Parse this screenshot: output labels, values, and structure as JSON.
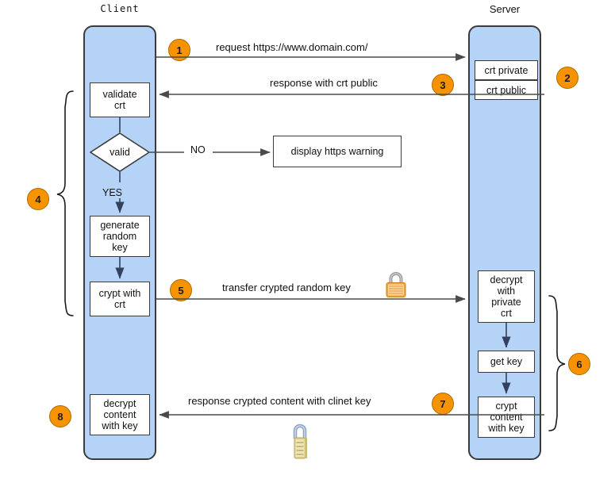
{
  "diagram": {
    "title_client": "Client",
    "title_server": "Server",
    "lanes": [
      {
        "name": "client",
        "label": "Client"
      },
      {
        "name": "server",
        "label": "Server"
      }
    ],
    "client_nodes": [
      {
        "id": "validate-crt",
        "label": "validate\ncrt"
      },
      {
        "id": "valid-decision",
        "label": "valid"
      },
      {
        "id": "generate-random-key",
        "label": "generate\nrandom\nkey"
      },
      {
        "id": "crypt-with-crt",
        "label": "crypt with\ncrt"
      },
      {
        "id": "decrypt-content-with-key",
        "label": "decrypt\ncontent\nwith key"
      }
    ],
    "server_nodes": [
      {
        "id": "crt-private",
        "label": "crt private"
      },
      {
        "id": "crt-public",
        "label": "crt public"
      },
      {
        "id": "decrypt-with-private-crt",
        "label": "decrypt\nwith\nprivate\ncrt"
      },
      {
        "id": "get-key",
        "label": "get key"
      },
      {
        "id": "crypt-content-with-key",
        "label": "crypt\ncontent\nwith key"
      }
    ],
    "external_nodes": [
      {
        "id": "display-https-warning",
        "label": "display https warning"
      }
    ],
    "edge_labels": {
      "no": "NO",
      "yes": "YES"
    },
    "messages": [
      {
        "id": "request",
        "label": "request https://www.domain.com/",
        "badge": "1"
      },
      {
        "id": "response-crt-public",
        "label": "response with crt public",
        "badge": "3"
      },
      {
        "id": "transfer-key",
        "label": "transfer crypted random key",
        "badge": "5"
      },
      {
        "id": "response-content",
        "label": "response crypted content with clinet key",
        "badge": "7"
      }
    ],
    "badges": [
      {
        "id": "badge-1",
        "label": "1"
      },
      {
        "id": "badge-2",
        "label": "2"
      },
      {
        "id": "badge-3",
        "label": "3"
      },
      {
        "id": "badge-4",
        "label": "4"
      },
      {
        "id": "badge-5",
        "label": "5"
      },
      {
        "id": "badge-6",
        "label": "6"
      },
      {
        "id": "badge-7",
        "label": "7"
      },
      {
        "id": "badge-8",
        "label": "8"
      }
    ],
    "icons": [
      {
        "id": "padlock-orange",
        "name": "padlock-icon"
      },
      {
        "id": "padlock-combination",
        "name": "combination-padlock-icon"
      }
    ],
    "colors": {
      "lane_fill": "#b5d2f7",
      "lane_stroke": "#3b3b3b",
      "badge_fill": "#f79200",
      "badge_stroke": "#b06a00",
      "node_fill": "#ffffff",
      "node_stroke": "#3b3b3b",
      "arrow": "#4a4a4a",
      "text": "#111111",
      "lock_body_orange": "#f5b45c",
      "lock_body_gold": "#ddcf8e"
    }
  }
}
